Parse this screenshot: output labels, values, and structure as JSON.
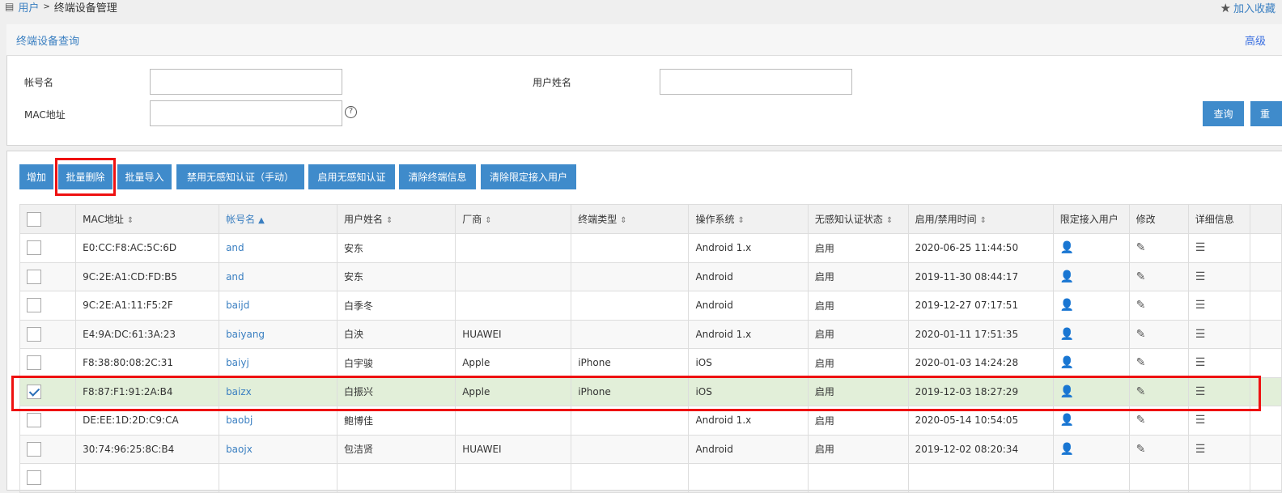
{
  "breadcrumb": {
    "parent": "用户",
    "sep": ">",
    "current": "终端设备管理"
  },
  "favorite_label": "加入收藏",
  "query": {
    "title": "终端设备查询",
    "advanced": "高级",
    "account_label": "帐号名",
    "name_label": "用户姓名",
    "mac_label": "MAC地址",
    "account_value": "",
    "name_value": "",
    "mac_value": "",
    "search": "查询",
    "reset": "重"
  },
  "toolbar": [
    "增加",
    "批量删除",
    "批量导入",
    "禁用无感知认证（手动）",
    "启用无感知认证",
    "清除终端信息",
    "清除限定接入用户"
  ],
  "columns": [
    "MAC地址",
    "帐号名",
    "用户姓名",
    "厂商",
    "终端类型",
    "操作系统",
    "无感知认证状态",
    "启用/禁用时间",
    "限定接入用户",
    "修改",
    "详细信息"
  ],
  "rows": [
    {
      "mac": "E0:CC:F8:AC:5C:6D",
      "account": "and",
      "name": "安东",
      "vendor": "",
      "type": "",
      "os": "Android 1.x",
      "status": "启用",
      "time": "2020-06-25 11:44:50",
      "checked": false
    },
    {
      "mac": "9C:2E:A1:CD:FD:B5",
      "account": "and",
      "name": "安东",
      "vendor": "",
      "type": "",
      "os": "Android",
      "status": "启用",
      "time": "2019-11-30 08:44:17",
      "checked": false
    },
    {
      "mac": "9C:2E:A1:11:F5:2F",
      "account": "baijd",
      "name": "白季冬",
      "vendor": "",
      "type": "",
      "os": "Android",
      "status": "启用",
      "time": "2019-12-27 07:17:51",
      "checked": false
    },
    {
      "mac": "E4:9A:DC:61:3A:23",
      "account": "baiyang",
      "name": "白泱",
      "vendor": "HUAWEI",
      "type": "",
      "os": "Android 1.x",
      "status": "启用",
      "time": "2020-01-11 17:51:35",
      "checked": false
    },
    {
      "mac": "F8:38:80:08:2C:31",
      "account": "baiyj",
      "name": "白宇骏",
      "vendor": "Apple",
      "type": "iPhone",
      "os": "iOS",
      "status": "启用",
      "time": "2020-01-03 14:24:28",
      "checked": false
    },
    {
      "mac": "F8:87:F1:91:2A:B4",
      "account": "baizx",
      "name": "白振兴",
      "vendor": "Apple",
      "type": "iPhone",
      "os": "iOS",
      "status": "启用",
      "time": "2019-12-03 18:27:29",
      "checked": true
    },
    {
      "mac": "DE:EE:1D:2D:C9:CA",
      "account": "baobj",
      "name": "鲍博佳",
      "vendor": "",
      "type": "",
      "os": "Android 1.x",
      "status": "启用",
      "time": "2020-05-14 10:54:05",
      "checked": false
    },
    {
      "mac": "30:74:96:25:8C:B4",
      "account": "baojx",
      "name": "包洁贤",
      "vendor": "HUAWEI",
      "type": "",
      "os": "Android",
      "status": "启用",
      "time": "2019-12-02 08:20:34",
      "checked": false
    }
  ]
}
